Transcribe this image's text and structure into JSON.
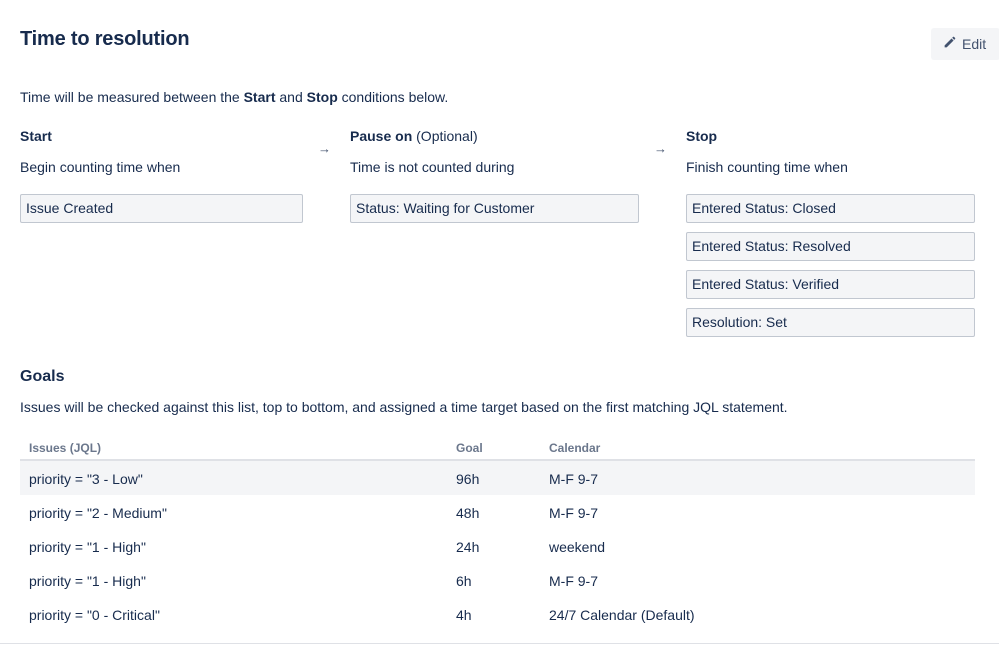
{
  "header": {
    "title": "Time to resolution",
    "edit_label": "Edit"
  },
  "intro": {
    "prefix": "Time will be measured between the ",
    "start_word": "Start",
    "middle": " and ",
    "stop_word": "Stop",
    "suffix": " conditions below."
  },
  "columns": {
    "start": {
      "title": "Start",
      "subtitle": "Begin counting time when",
      "conditions": [
        "Issue Created"
      ]
    },
    "pause": {
      "title": "Pause on",
      "optional": "(Optional)",
      "subtitle": "Time is not counted during",
      "conditions": [
        "Status: Waiting for Customer"
      ]
    },
    "stop": {
      "title": "Stop",
      "subtitle": "Finish counting time when",
      "conditions": [
        "Entered Status: Closed",
        "Entered Status: Resolved",
        "Entered Status: Verified",
        "Resolution: Set"
      ]
    },
    "arrow_glyph": "→"
  },
  "goals": {
    "title": "Goals",
    "description": "Issues will be checked against this list, top to bottom, and assigned a time target based on the first matching JQL statement.",
    "table": {
      "headers": {
        "issues": "Issues",
        "jql": "(JQL)",
        "goal": "Goal",
        "calendar": "Calendar"
      },
      "rows": [
        {
          "issues": "priority = \"3 - Low\"",
          "goal": "96h",
          "calendar": "M-F 9-7"
        },
        {
          "issues": "priority = \"2 - Medium\"",
          "goal": "48h",
          "calendar": "M-F 9-7"
        },
        {
          "issues": "priority = \"1 - High\"",
          "goal": "24h",
          "calendar": "weekend"
        },
        {
          "issues": "priority = \"1 - High\"",
          "goal": "6h",
          "calendar": "M-F 9-7"
        },
        {
          "issues": "priority = \"0 - Critical\"",
          "goal": "4h",
          "calendar": "24/7 Calendar (Default)"
        }
      ]
    }
  },
  "icons": {
    "edit": "pencil-icon",
    "arrow": "arrow-right-icon"
  }
}
